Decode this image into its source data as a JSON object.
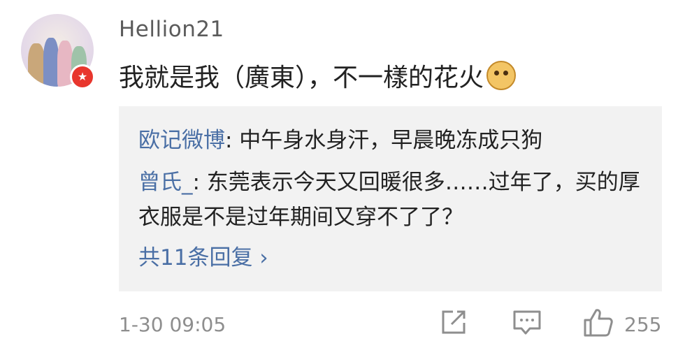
{
  "comment": {
    "username": "Hellion21",
    "text": "我就是我（廣東），不一樣的花火",
    "emoji": "doge-emoji",
    "timestamp": "1-30 09:05",
    "like_count": "255"
  },
  "replies": [
    {
      "name": "欧记微博",
      "text": ": 中午身水身汗，早晨晚冻成只狗"
    },
    {
      "name": "曾氏_",
      "text": ": 东莞表示今天又回暖很多……过年了，买的厚衣服是不是过年期间又穿不了了？"
    }
  ],
  "replies_more": "共11条回复 ›",
  "icons": {
    "share": "share-icon",
    "reply": "comment-icon",
    "like": "thumbs-up-icon",
    "badge": "verified-badge-icon"
  },
  "colors": {
    "link": "#4a6fa5",
    "badge": "#e8362d",
    "reply_bg": "#f2f2f2"
  }
}
